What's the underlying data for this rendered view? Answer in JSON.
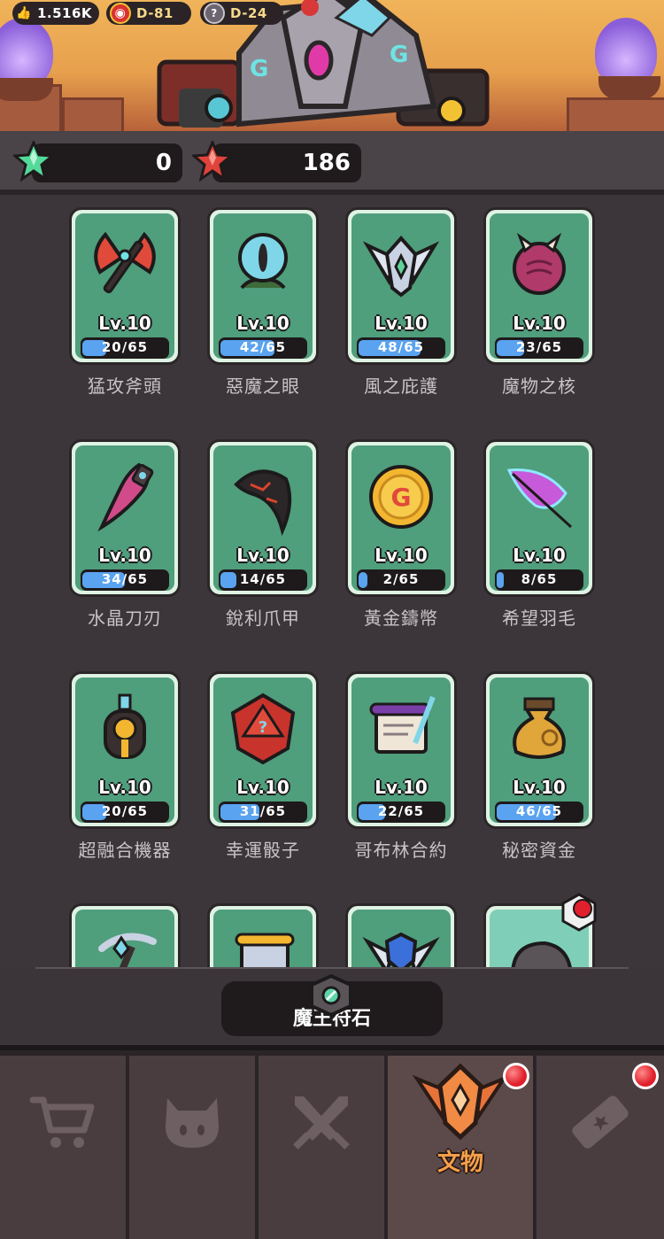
{
  "top_stats": {
    "likes": "1.516K",
    "stage_a": "D-81",
    "stage_b": "D-24"
  },
  "currency": {
    "green_gems": "0",
    "red_gems": "186"
  },
  "relics": [
    {
      "level": "Lv.10",
      "progress": "20/65",
      "progress_value": 20,
      "progress_max": 65,
      "name": "猛攻斧頭",
      "icon": "axe-icon"
    },
    {
      "level": "Lv.10",
      "progress": "42/65",
      "progress_value": 42,
      "progress_max": 65,
      "name": "惡魔之眼",
      "icon": "demon-eye-icon"
    },
    {
      "level": "Lv.10",
      "progress": "48/65",
      "progress_value": 48,
      "progress_max": 65,
      "name": "風之庇護",
      "icon": "wing-emblem-icon"
    },
    {
      "level": "Lv.10",
      "progress": "23/65",
      "progress_value": 23,
      "progress_max": 65,
      "name": "魔物之核",
      "icon": "monster-core-icon"
    },
    {
      "level": "Lv.10",
      "progress": "34/65",
      "progress_value": 34,
      "progress_max": 65,
      "name": "水晶刀刃",
      "icon": "crystal-blade-icon"
    },
    {
      "level": "Lv.10",
      "progress": "14/65",
      "progress_value": 14,
      "progress_max": 65,
      "name": "銳利爪甲",
      "icon": "claw-icon"
    },
    {
      "level": "Lv.10",
      "progress": "2/65",
      "progress_value": 2,
      "progress_max": 65,
      "name": "黃金鑄幣",
      "icon": "gold-coin-icon"
    },
    {
      "level": "Lv.10",
      "progress": "8/65",
      "progress_value": 8,
      "progress_max": 65,
      "name": "希望羽毛",
      "icon": "feather-icon"
    },
    {
      "level": "Lv.10",
      "progress": "20/65",
      "progress_value": 20,
      "progress_max": 65,
      "name": "超融合機器",
      "icon": "machine-icon"
    },
    {
      "level": "Lv.10",
      "progress": "31/65",
      "progress_value": 31,
      "progress_max": 65,
      "name": "幸運骰子",
      "icon": "dice-icon"
    },
    {
      "level": "Lv.10",
      "progress": "22/65",
      "progress_value": 22,
      "progress_max": 65,
      "name": "哥布林合約",
      "icon": "contract-icon"
    },
    {
      "level": "Lv.10",
      "progress": "46/65",
      "progress_value": 46,
      "progress_max": 65,
      "name": "秘密資金",
      "icon": "money-bag-icon"
    }
  ],
  "partial_row_icons": [
    "pickaxe-icon",
    "scroll-icon",
    "banner-shield-icon",
    "helmet-icon"
  ],
  "rune_button": {
    "label": "魔王符石"
  },
  "nav": {
    "tabs": [
      {
        "icon": "cart-icon"
      },
      {
        "icon": "demon-face-icon"
      },
      {
        "icon": "crossed-swords-icon"
      },
      {
        "icon": "relic-emblem-icon",
        "label": "文物",
        "active": true
      },
      {
        "icon": "ticket-icon"
      }
    ]
  }
}
